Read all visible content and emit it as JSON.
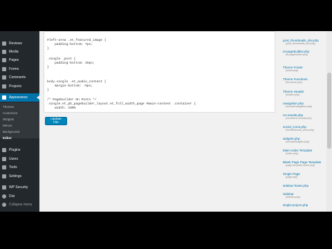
{
  "sidebar": {
    "items": [
      {
        "label": "Reviews",
        "icon": "star-icon"
      },
      {
        "label": "Media",
        "icon": "media-icon"
      },
      {
        "label": "Pages",
        "icon": "pages-icon"
      },
      {
        "label": "Forms",
        "icon": "forms-icon"
      },
      {
        "label": "Comments",
        "icon": "comments-icon"
      },
      {
        "label": "Projects",
        "icon": "projects-icon"
      },
      {
        "label": "Appearance",
        "icon": "brush-icon"
      }
    ],
    "submenu": [
      "Themes",
      "Customize",
      "Widgets",
      "Menus",
      "Background",
      "Editor"
    ],
    "items2": [
      {
        "label": "Plugins",
        "icon": "plugin-icon"
      },
      {
        "label": "Users",
        "icon": "users-icon"
      },
      {
        "label": "Tools",
        "icon": "tools-icon"
      },
      {
        "label": "Settings",
        "icon": "settings-icon"
      },
      {
        "label": "WP Security",
        "icon": "shield-icon"
      },
      {
        "label": "Divi",
        "icon": "divi-icon"
      },
      {
        "label": "Collapse menu",
        "icon": "collapse-icon"
      }
    ]
  },
  "editor": {
    "lines": [
      "#left-area .et_featured_image {",
      "    padding-bottom: 7px;",
      "}",
      "",
      ".single .post {",
      "    padding-bottom: 25px;",
      "}",
      "",
      "",
      "body.single .et_audio_content {",
      "    margin-bottom: -6px;",
      "}",
      "",
      "/* Pagebuilder On Posts */",
      ".single.et_pb_pagebuilder_layout.et_full_width_page #main-content .container {",
      "    width: 100%"
    ]
  },
  "update_button": "Update File",
  "files": [
    {
      "name": "post_thumbnails_divi.php",
      "desc": "(post_thumbnails_divi.php)"
    },
    {
      "name": "et-pagebuilder.php",
      "desc": "(et-pagebuilder.php)"
    },
    {
      "name": "Theme Footer",
      "desc": "(footer.php)"
    },
    {
      "name": "Theme Functions",
      "desc": "(functions.php)"
    },
    {
      "name": "Theme Header",
      "desc": "(header.php)"
    },
    {
      "name": "navigation.php",
      "desc": "(include/navigation.php)"
    },
    {
      "name": "no-results.php",
      "desc": "(include/no-results.php)"
    },
    {
      "name": "social_icons.php",
      "desc": "(include/social_icons.php)"
    },
    {
      "name": "widgets.php",
      "desc": "(include/widgets.php)"
    },
    {
      "name": "Main Index Template",
      "desc": "(index.php)"
    },
    {
      "name": "Blank Page Page Template",
      "desc": "(page-template-blank.php)"
    },
    {
      "name": "Single Page",
      "desc": "(page.php)"
    },
    {
      "name": "sidebar-footer.php",
      "desc": ""
    },
    {
      "name": "Sidebar",
      "desc": "(sidebar.php)"
    },
    {
      "name": "single-project.php",
      "desc": ""
    }
  ]
}
